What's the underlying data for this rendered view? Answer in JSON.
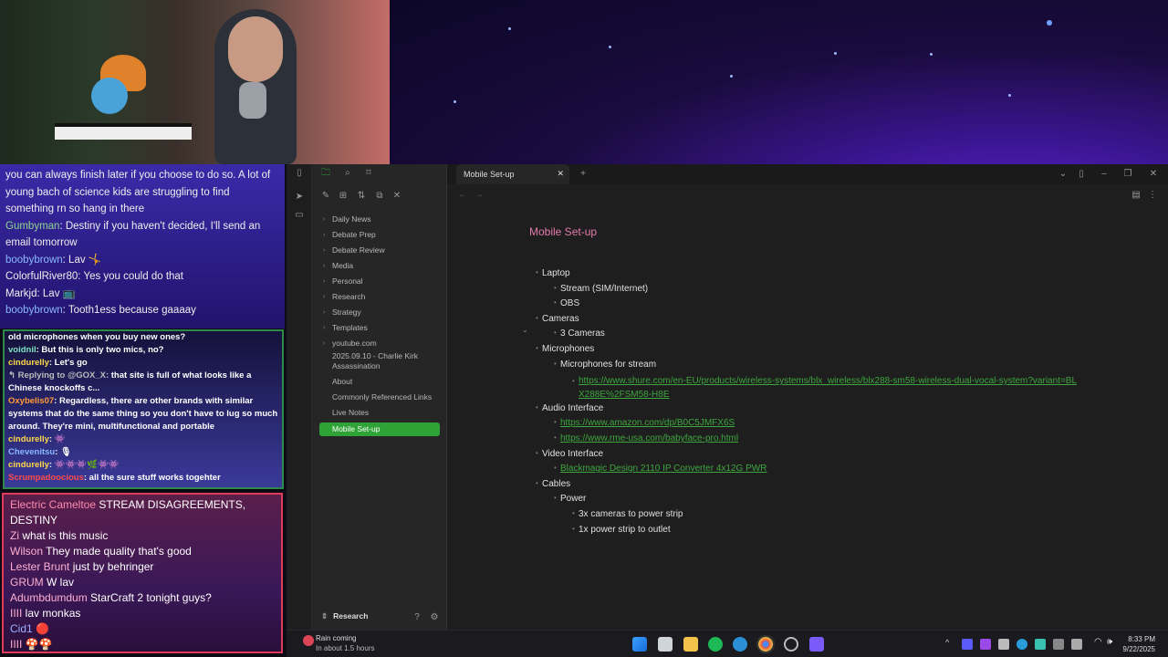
{
  "chat_top": [
    {
      "user": "",
      "text": "you can always finish later if you choose to do so. A lot of young bach of science kids are struggling to find something rn so hang in there",
      "color": "#eeeeee"
    },
    {
      "user": "Gumbyman",
      "text": ": Destiny if you haven't decided, I'll send an email tomorrow",
      "color": "#8fd48f"
    },
    {
      "user": "boobybrown",
      "text": ": Lav 🤸",
      "color": "#8ab8ff"
    },
    {
      "user": "ColorfulRiver80",
      "text": ": Yes you could do that",
      "color": "#eeeeee"
    },
    {
      "user": "Markjd",
      "text": ": Lav 📺",
      "color": "#eeeeee"
    },
    {
      "user": "boobybrown",
      "text": ": Tooth1ess because gaaaay",
      "color": "#8ab8ff"
    }
  ],
  "chat_mid": [
    {
      "user": "",
      "text": "old microphones when you buy new ones?",
      "color": "#ffffff"
    },
    {
      "user": "voidnil",
      "text": ": But this is only two mics, no?",
      "color": "#7fe3c0"
    },
    {
      "user": "cindurelly",
      "text": ": Let's go",
      "color": "#ffd84a"
    },
    {
      "user": "↰ Replying to @GOX_X:",
      "text": " that site is full of what looks like a Chinese knockoffs c...",
      "color": "#bbbbbb"
    },
    {
      "user": "Oxybelis07",
      "text": ": Regardless, there are other brands with similar systems that do the same thing so you don't have to lug so much around. They're mini, multifunctional and portable",
      "color": "#ff9a3a"
    },
    {
      "user": "cindurelly",
      "text": ": 👾",
      "color": "#ffd84a"
    },
    {
      "user": "Chevenitsu",
      "text": ": 🎙",
      "color": "#8ab8ff"
    },
    {
      "user": "cindurelly",
      "text": ": 👾👾👾🌿👾👾",
      "color": "#ffd84a"
    },
    {
      "user": "Scrumpadoocious",
      "text": ": all the sure stuff works togehter",
      "color": "#ff4a4a"
    }
  ],
  "chat_bottom": [
    {
      "user": "Electric Cameltoe",
      "text": " STREAM DISAGREEMENTS, DESTINY",
      "color": "#ff8ab0"
    },
    {
      "user": "Zi",
      "text": " what is this music",
      "color": "#ffb0d0"
    },
    {
      "user": "Wilson",
      "text": " They made quality that's good",
      "color": "#ffb0d0"
    },
    {
      "user": "Lester Brunt",
      "text": " just by behringer",
      "color": "#ffb0d0"
    },
    {
      "user": "GRUM",
      "text": " W lav",
      "color": "#ffb0d0"
    },
    {
      "user": "Adumbdumdum",
      "text": " StarCraft 2 tonight guys?",
      "color": "#ffb0d0"
    },
    {
      "user": "IIII",
      "text": " lav monkas",
      "color": "#ffb0d0"
    },
    {
      "user": "Cid1",
      "text": " 🔴",
      "color": "#9ab0ff"
    },
    {
      "user": "IIII",
      "text": " 🍄🍄",
      "color": "#ffb0d0"
    }
  ],
  "obsidian": {
    "tab_label": "Mobile Set-up",
    "vault_name": "Research",
    "folders": [
      "Daily News",
      "Debate Prep",
      "Debate Review",
      "Media",
      "Personal",
      "Research",
      "Strategy",
      "Templates",
      "youtube.com"
    ],
    "files": [
      "2025.09.10 - Charlie Kirk Assassination",
      "About",
      "Commonly Referenced Links",
      "Live Notes",
      "Mobile Set-up"
    ],
    "note_title": "Mobile Set-up",
    "outline": [
      {
        "level": 0,
        "text": "Laptop",
        "link": false
      },
      {
        "level": 1,
        "text": "Stream (SIM/Internet)",
        "link": false
      },
      {
        "level": 1,
        "text": "OBS",
        "link": false
      },
      {
        "level": 0,
        "text": "Cameras",
        "link": false
      },
      {
        "level": 1,
        "text": "3 Cameras",
        "link": false
      },
      {
        "level": 0,
        "text": "Microphones",
        "link": false
      },
      {
        "level": 1,
        "text": "Microphones for stream",
        "link": false
      },
      {
        "level": 2,
        "text": "https://www.shure.com/en-EU/products/wireless-systems/blx_wireless/blx288-sm58-wireless-dual-vocal-system?variant=BLX288E%2FSM58-H8E",
        "link": true
      },
      {
        "level": 0,
        "text": "Audio Interface",
        "link": false
      },
      {
        "level": 1,
        "text": "https://www.amazon.com/dp/B0C5JMFX6S",
        "link": true
      },
      {
        "level": 1,
        "text": "https://www.rme-usa.com/babyface-pro.html",
        "link": true
      },
      {
        "level": 0,
        "text": "Video Interface",
        "link": false
      },
      {
        "level": 1,
        "text": "Blackmagic Design 2110 IP Converter 4x12G PWR",
        "link": true
      },
      {
        "level": 0,
        "text": "Cables",
        "link": false
      },
      {
        "level": 1,
        "text": "Power",
        "link": false
      },
      {
        "level": 2,
        "text": "3x cameras to power strip",
        "link": false
      },
      {
        "level": 2,
        "text": "1x power strip to outlet",
        "link": false
      }
    ]
  },
  "taskbar": {
    "weather_title": "Rain coming",
    "weather_sub": "In about 1.5 hours",
    "time": "8:33 PM",
    "date": "9/22/2025"
  },
  "colors": {
    "accent": "#2fa335",
    "title": "#e27bab",
    "link": "#3fa63f"
  }
}
